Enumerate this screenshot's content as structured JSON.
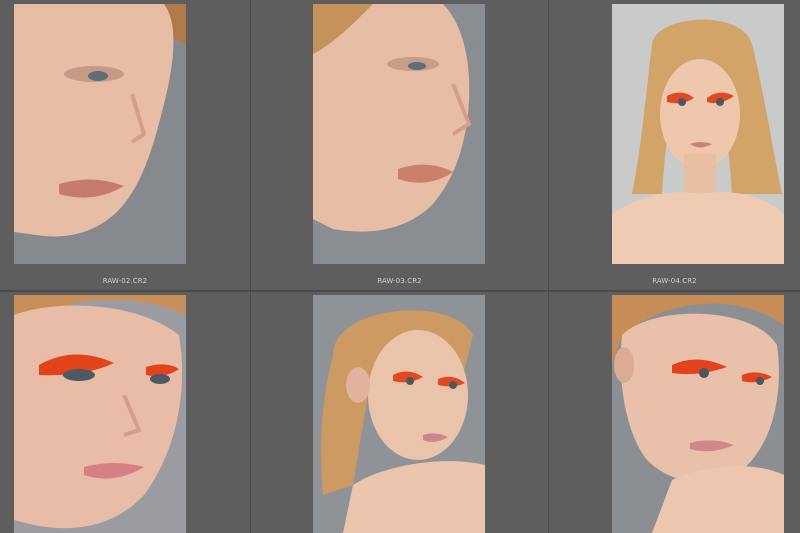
{
  "grid": {
    "top_row": [
      {
        "filename": "RAW-02.CR2",
        "icon": "portrait-closeup-profile-photo"
      },
      {
        "filename": "RAW-03.CR2",
        "icon": "portrait-profile-photo"
      },
      {
        "filename": "RAW-04.CR2",
        "icon": "portrait-front-orange-makeup-photo"
      }
    ],
    "bottom_row": [
      {
        "icon": "portrait-closeup-orange-makeup-photo"
      },
      {
        "icon": "portrait-turned-head-orange-makeup-photo"
      },
      {
        "icon": "portrait-three-quarter-orange-makeup-photo"
      }
    ]
  },
  "colors": {
    "background": "#5b5b5b",
    "cell": "#5e5e5e",
    "divider": "#4a4a4a",
    "caption": "#d0d0d0",
    "backdrop_gray": "#8c8f93",
    "backdrop_light": "#c7c8c8",
    "skin": "#eac1ab",
    "hair": "#c98c4f",
    "eyeshadow": "#e4421d"
  }
}
